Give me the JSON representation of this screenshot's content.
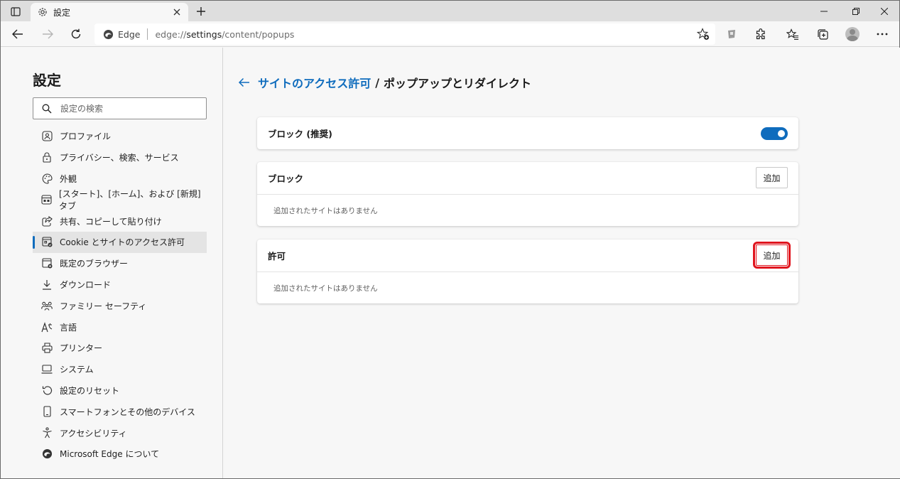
{
  "tab": {
    "title": "設定"
  },
  "address": {
    "edge_label": "Edge",
    "url_prefix": "edge://",
    "url_host": "settings",
    "url_path": "/content/popups"
  },
  "sidebar": {
    "title": "設定",
    "search_placeholder": "設定の検索",
    "items": [
      {
        "label": "プロファイル",
        "icon": "profile-icon"
      },
      {
        "label": "プライバシー、検索、サービス",
        "icon": "lock-icon"
      },
      {
        "label": "外観",
        "icon": "palette-icon"
      },
      {
        "label": "[スタート]、[ホーム]、および [新規] タブ",
        "icon": "home-tabs-icon"
      },
      {
        "label": "共有、コピーして貼り付け",
        "icon": "share-icon"
      },
      {
        "label": "Cookie とサイトのアクセス許可",
        "icon": "cookie-permissions-icon",
        "active": true
      },
      {
        "label": "既定のブラウザー",
        "icon": "default-browser-icon"
      },
      {
        "label": "ダウンロード",
        "icon": "download-icon"
      },
      {
        "label": "ファミリー セーフティ",
        "icon": "family-icon"
      },
      {
        "label": "言語",
        "icon": "language-icon"
      },
      {
        "label": "プリンター",
        "icon": "printer-icon"
      },
      {
        "label": "システム",
        "icon": "system-icon"
      },
      {
        "label": "設定のリセット",
        "icon": "reset-icon"
      },
      {
        "label": "スマートフォンとその他のデバイス",
        "icon": "phone-icon"
      },
      {
        "label": "アクセシビリティ",
        "icon": "accessibility-icon"
      },
      {
        "label": "Microsoft Edge について",
        "icon": "edge-logo-icon"
      }
    ]
  },
  "main": {
    "breadcrumb_link": "サイトのアクセス許可",
    "breadcrumb_sep": "/",
    "breadcrumb_current": "ポップアップとリダイレクト",
    "block_recommended": {
      "label": "ブロック (推奨)",
      "enabled": true
    },
    "block": {
      "label": "ブロック",
      "add": "追加",
      "empty": "追加されたサイトはありません"
    },
    "allow": {
      "label": "許可",
      "add": "追加",
      "empty": "追加されたサイトはありません"
    }
  },
  "colors": {
    "accent": "#0f6cbd",
    "highlight": "#e0141e"
  }
}
